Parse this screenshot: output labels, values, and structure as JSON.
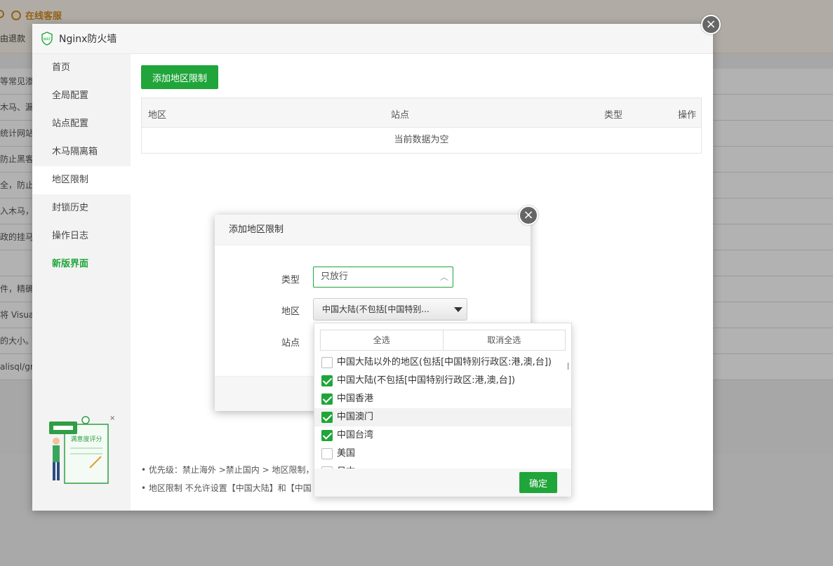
{
  "background": {
    "service_label": "在线客服",
    "refund_label": "由退款",
    "rows": [
      "等常见渗",
      "木马、漏",
      "统计网站",
      "防止黑客",
      "全，防止",
      "入木马，",
      "政的挂马和",
      "",
      "件，精确",
      "将 Visua",
      "的大小。",
      "alisql/gr"
    ]
  },
  "waf": {
    "title": "Nginx防火墙",
    "logo_text": "WAF",
    "close_icon": "×",
    "sidebar": [
      {
        "label": "首页"
      },
      {
        "label": "全局配置"
      },
      {
        "label": "站点配置"
      },
      {
        "label": "木马隔离箱"
      },
      {
        "label": "地区限制"
      },
      {
        "label": "封锁历史"
      },
      {
        "label": "操作日志"
      },
      {
        "label": "新版界面"
      }
    ],
    "rating_label": "满意度评分",
    "add_button": "添加地区限制",
    "table": {
      "columns": [
        "地区",
        "站点",
        "类型",
        "操作"
      ],
      "empty_text": "当前数据为空"
    },
    "notes": [
      "• 优先级：禁止海外 >禁止国内 > 地区限制，如",
      "• 地区限制 不允许设置【中国大陆】和【中国"
    ]
  },
  "dialog": {
    "title": "添加地区限制",
    "close_icon": "×",
    "type_label": "类型",
    "type_value": "只放行",
    "region_label": "地区",
    "region_value": "中国大陆(不包括[中国特别...",
    "site_label": "站点"
  },
  "dropdown": {
    "select_all": "全选",
    "deselect_all": "取消全选",
    "items": [
      {
        "label": "中国大陆以外的地区(包括[中国特别行政区:港,澳,台])",
        "checked": false
      },
      {
        "label": "中国大陆(不包括[中国特别行政区:港,澳,台])",
        "checked": true
      },
      {
        "label": "中国香港",
        "checked": true
      },
      {
        "label": "中国澳门",
        "checked": true
      },
      {
        "label": "中国台湾",
        "checked": true
      },
      {
        "label": "美国",
        "checked": false
      },
      {
        "label": "日本",
        "checked": false
      }
    ],
    "confirm": "确定"
  },
  "colors": {
    "accent": "#20a53a",
    "service": "#d38c22"
  }
}
